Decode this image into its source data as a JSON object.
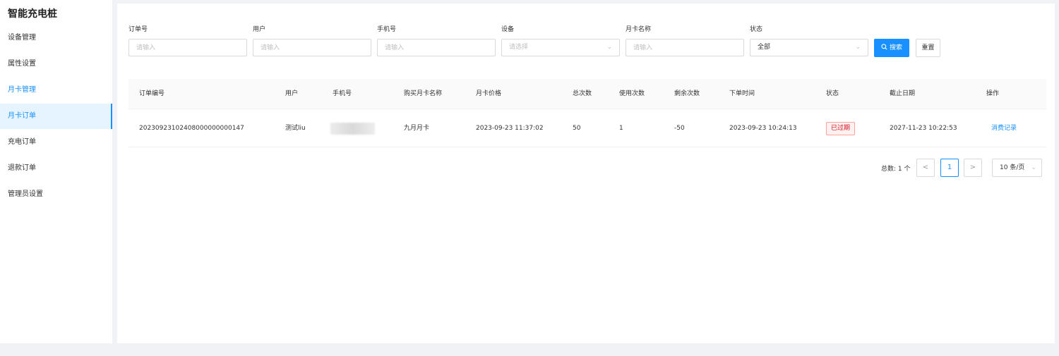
{
  "app": {
    "title": "智能充电桩"
  },
  "sidebar": {
    "items": [
      {
        "label": "设备管理"
      },
      {
        "label": "属性设置"
      },
      {
        "label": "月卡管理"
      },
      {
        "label": "月卡订单"
      },
      {
        "label": "充电订单"
      },
      {
        "label": "退款订单"
      },
      {
        "label": "管理员设置"
      }
    ]
  },
  "filters": {
    "order_no": {
      "label": "订单号",
      "placeholder": "请输入"
    },
    "user": {
      "label": "用户",
      "placeholder": "请输入"
    },
    "phone": {
      "label": "手机号",
      "placeholder": "请输入"
    },
    "device": {
      "label": "设备",
      "placeholder": "请选择"
    },
    "card_name": {
      "label": "月卡名称",
      "placeholder": "请输入"
    },
    "status": {
      "label": "状态",
      "value": "全部"
    },
    "search_label": "搜索",
    "reset_label": "重置"
  },
  "table": {
    "columns": [
      "订单编号",
      "用户",
      "手机号",
      "购买月卡名称",
      "月卡价格",
      "总次数",
      "使用次数",
      "剩余次数",
      "下单时间",
      "状态",
      "截止日期",
      "操作"
    ],
    "rows": [
      {
        "order_no": "20230923102408000000000147",
        "user": "测试liu",
        "card_name": "九月月卡",
        "price": "2023-09-23 11:37:02",
        "total": "50",
        "used": "1",
        "remaining": "-50",
        "order_time": "2023-09-23 10:24:13",
        "status": "已过期",
        "deadline": "2027-11-23 10:22:53",
        "action": "消费记录"
      }
    ]
  },
  "pagination": {
    "total": "总数: 1 个",
    "prev": "<",
    "page": "1",
    "next": ">",
    "page_size": "10 条/页"
  },
  "colors": {
    "primary": "#1890ff",
    "expired_tag": "#cf1322"
  }
}
